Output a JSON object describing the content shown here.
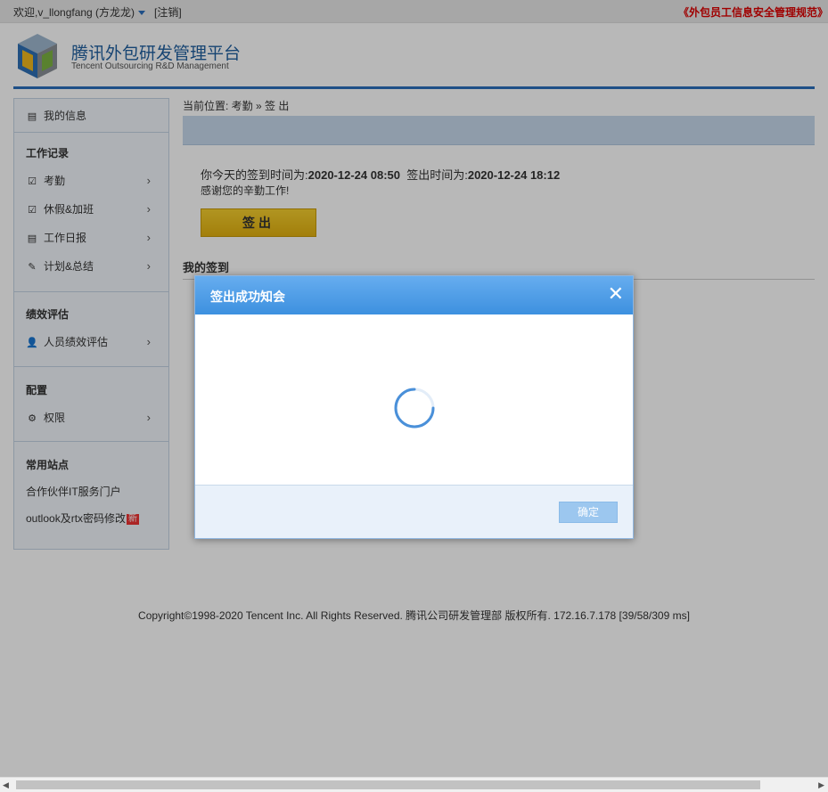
{
  "topbar": {
    "welcome": "欢迎,v_llongfang (方龙龙)",
    "logout": "[注销]",
    "policy_link": "《外包员工信息安全管理规范》"
  },
  "header": {
    "title": "腾讯外包研发管理平台",
    "subtitle": "Tencent Outsourcing R&D Management"
  },
  "sidebar": {
    "my_info": "我的信息",
    "work_record": {
      "heading": "工作记录",
      "items": [
        "考勤",
        "休假&加班",
        "工作日报",
        "计划&总结"
      ]
    },
    "performance": {
      "heading": "绩效评估",
      "items": [
        "人员绩效评估"
      ]
    },
    "config": {
      "heading": "配置",
      "items": [
        "权限"
      ]
    },
    "sites": {
      "heading": "常用站点",
      "links": [
        "合作伙伴IT服务门户",
        "outlook及rtx密码修改"
      ],
      "new_badge": "新"
    }
  },
  "main": {
    "breadcrumb": "当前位置: 考勤 » 签 出",
    "signin_label": "你今天的签到时间为:",
    "signin_time": "2020-12-24 08:50",
    "signout_label": "签出时间为:",
    "signout_time": "2020-12-24 18:12",
    "thanks": "感谢您的辛勤工作!",
    "signout_button": "签出",
    "my_signin_title": "我的签到"
  },
  "modal": {
    "title": "签出成功知会",
    "close": "✕",
    "ok_button": "确定"
  },
  "footer": {
    "text": "Copyright©1998-2020 Tencent Inc. All Rights Reserved. 腾讯公司研发管理部 版权所有. 172.16.7.178 [39/58/309 ms]"
  },
  "colors": {
    "brand_blue": "#2a6ebb",
    "button_yellow": "#e8b81a",
    "modal_header": "#4a9be5",
    "policy_red": "#dd0000"
  }
}
